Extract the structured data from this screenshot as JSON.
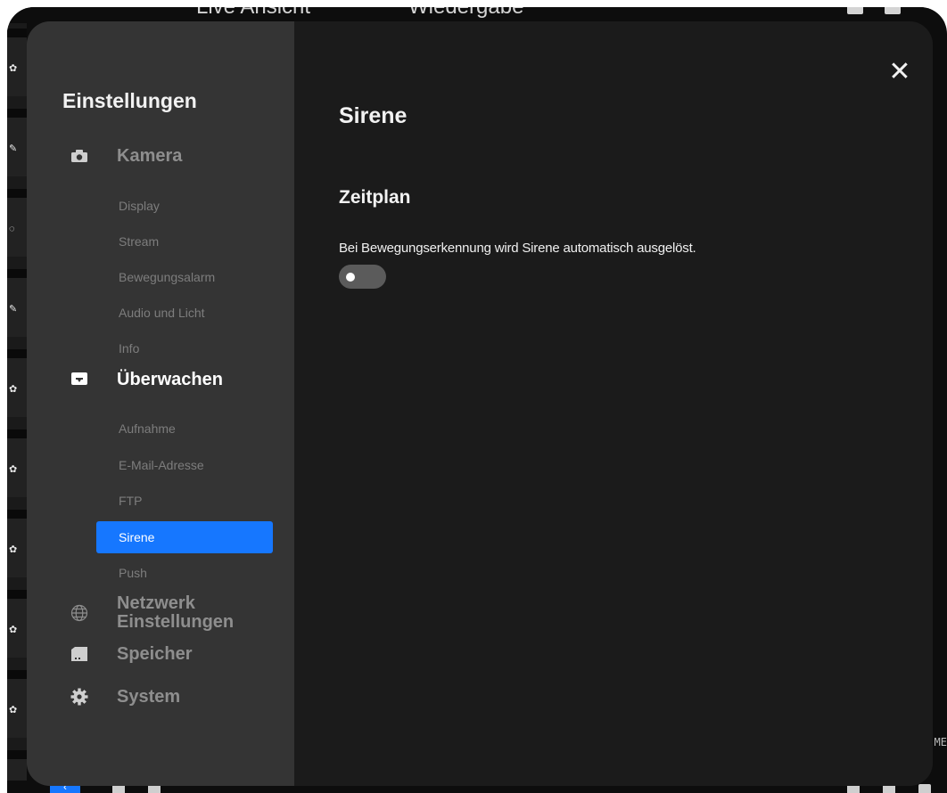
{
  "background": {
    "tabs": [
      "Live Ansicht",
      "Wiedergabe"
    ],
    "right_label": "ME"
  },
  "settings": {
    "title": "Einstellungen",
    "categories": [
      {
        "label": "Kamera",
        "icon": "camera-icon",
        "items": [
          "Display",
          "Stream",
          "Bewegungsalarm",
          "Audio und Licht",
          "Info"
        ]
      },
      {
        "label": "Überwachen",
        "icon": "monitor-icon",
        "items": [
          "Aufnahme",
          "E-Mail-Adresse",
          "FTP",
          "Sirene",
          "Push"
        ]
      },
      {
        "label": "Netzwerk Einstellungen",
        "icon": "globe-icon",
        "items": []
      },
      {
        "label": "Speicher",
        "icon": "sd-card-icon",
        "items": []
      },
      {
        "label": "System",
        "icon": "gear-icon",
        "items": []
      }
    ],
    "selected_item": "Sirene"
  },
  "content": {
    "close_icon": "close-icon",
    "page_title": "Sirene",
    "section_title": "Zeitplan",
    "description": "Bei Bewegungserkennung wird Sirene automatisch ausgelöst.",
    "toggle_on": false
  },
  "colors": {
    "accent": "#1677ff",
    "sidebar_bg": "#343434",
    "content_bg": "#1b1b1b"
  }
}
